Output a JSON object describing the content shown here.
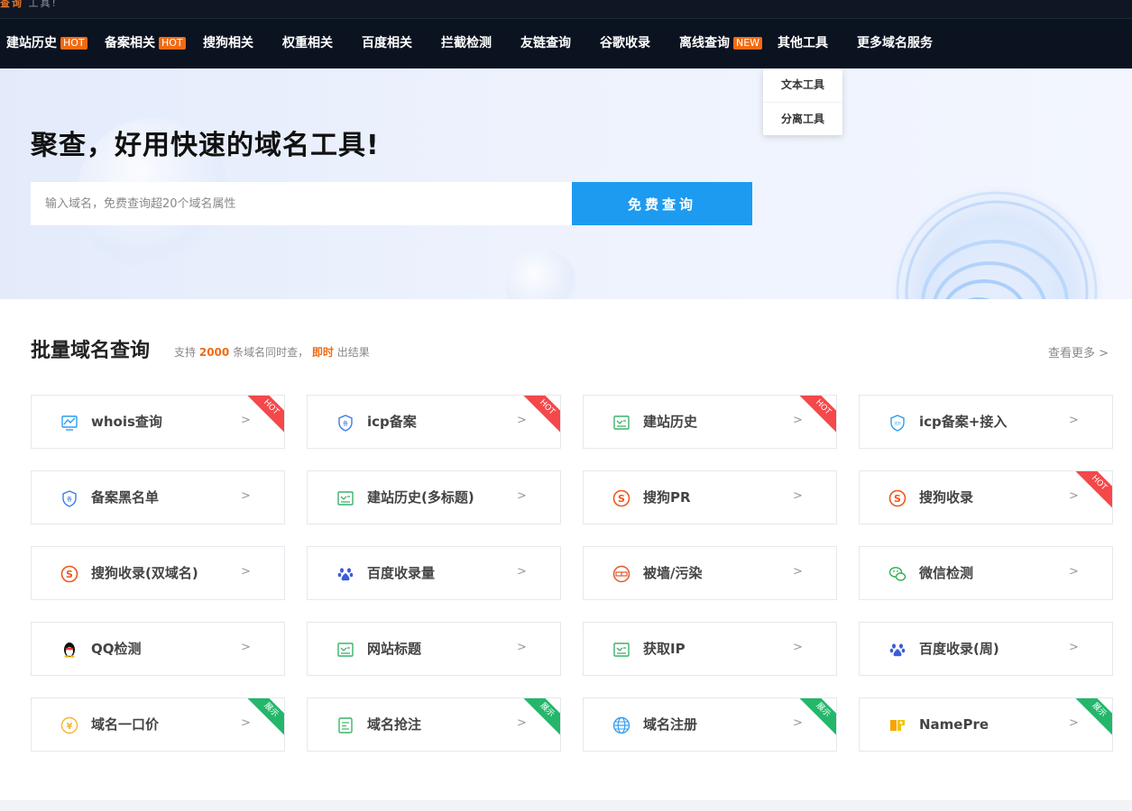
{
  "top_strip": {
    "text_highlight": "查询",
    "text_rest": "工具!"
  },
  "nav": {
    "items": [
      {
        "label": "建站历史",
        "tag": "HOT"
      },
      {
        "label": "备案相关",
        "tag": "HOT"
      },
      {
        "label": "搜狗相关"
      },
      {
        "label": "权重相关"
      },
      {
        "label": "百度相关"
      },
      {
        "label": "拦截检测"
      },
      {
        "label": "友链查询"
      },
      {
        "label": "谷歌收录"
      },
      {
        "label": "离线查询",
        "tag": "NEW"
      },
      {
        "label": "其他工具"
      },
      {
        "label": "更多域名服务"
      }
    ],
    "dropdown": [
      "文本工具",
      "分离工具"
    ]
  },
  "hero": {
    "title": "聚查，好用快速的域名工具!",
    "search_placeholder": "输入域名，免费查询超20个域名属性",
    "search_button": "免费查询"
  },
  "section": {
    "title": "批量域名查询",
    "sub_prefix": "支持",
    "sub_count": "2000",
    "sub_middle": "条域名同时查，",
    "sub_highlight": "即时",
    "sub_suffix": "出结果",
    "more": "查看更多 >"
  },
  "cards": [
    {
      "label": "whois查询",
      "icon": "whois-chart-icon",
      "badge": "HOT"
    },
    {
      "label": "icp备案",
      "icon": "icp-shield-icon",
      "badge": "HOT"
    },
    {
      "label": "建站历史",
      "icon": "history-doc-icon",
      "badge": "HOT"
    },
    {
      "label": "icp备案+接入",
      "icon": "icp-badge-icon"
    },
    {
      "label": "备案黑名单",
      "icon": "icp-shield-icon"
    },
    {
      "label": "建站历史(多标题)",
      "icon": "history-doc-icon"
    },
    {
      "label": "搜狗PR",
      "icon": "sogou-icon"
    },
    {
      "label": "搜狗收录",
      "icon": "sogou-icon",
      "badge": "HOT"
    },
    {
      "label": "搜狗收录(双域名)",
      "icon": "sogou-icon"
    },
    {
      "label": "百度收录量",
      "icon": "baidu-paw-icon"
    },
    {
      "label": "被墙/污染",
      "icon": "great-wall-icon"
    },
    {
      "label": "微信检测",
      "icon": "wechat-icon"
    },
    {
      "label": "QQ检测",
      "icon": "qq-penguin-icon"
    },
    {
      "label": "网站标题",
      "icon": "history-doc-icon"
    },
    {
      "label": "获取IP",
      "icon": "history-doc-icon"
    },
    {
      "label": "百度收录(周)",
      "icon": "baidu-paw-icon"
    },
    {
      "label": "域名一口价",
      "icon": "yuan-coin-icon",
      "badge": "展示"
    },
    {
      "label": "域名抢注",
      "icon": "snipe-doc-icon",
      "badge": "展示"
    },
    {
      "label": "域名注册",
      "icon": "globe-icon",
      "badge": "展示"
    },
    {
      "label": "NamePre",
      "icon": "namepre-logo-icon",
      "badge": "展示"
    }
  ],
  "card_arrow": ">",
  "colors": {
    "nav_bg": "#0b1220",
    "accent_orange": "#f26b12",
    "button_blue": "#1d9bf0",
    "hot_red": "#f5484a",
    "ad_green": "#25b66b"
  }
}
